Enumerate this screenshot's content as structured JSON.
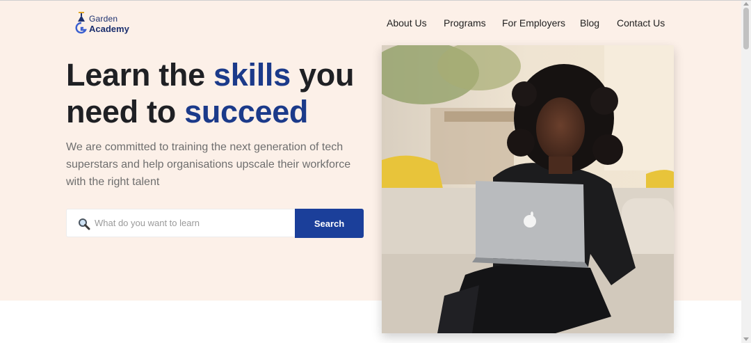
{
  "logo": {
    "line1": "Garden",
    "line2": "Academy"
  },
  "nav": {
    "items": [
      {
        "label": "About Us"
      },
      {
        "label": "Programs"
      },
      {
        "label": "For Employers"
      },
      {
        "label": "Blog"
      },
      {
        "label": "Contact Us"
      }
    ]
  },
  "hero": {
    "title_part1": "Learn the ",
    "title_accent1": "skills",
    "title_part2": " you need to ",
    "title_accent2": "succeed",
    "subtitle": "We are committed to training the next generation of tech superstars and help organisations upscale their workforce with the right talent"
  },
  "search": {
    "placeholder": "What do you want to learn",
    "value": "",
    "button_label": "Search",
    "icon": "search-icon"
  },
  "colors": {
    "hero_bg": "#fcf0e8",
    "accent": "#1b3a8a",
    "button": "#1b3f9a"
  }
}
